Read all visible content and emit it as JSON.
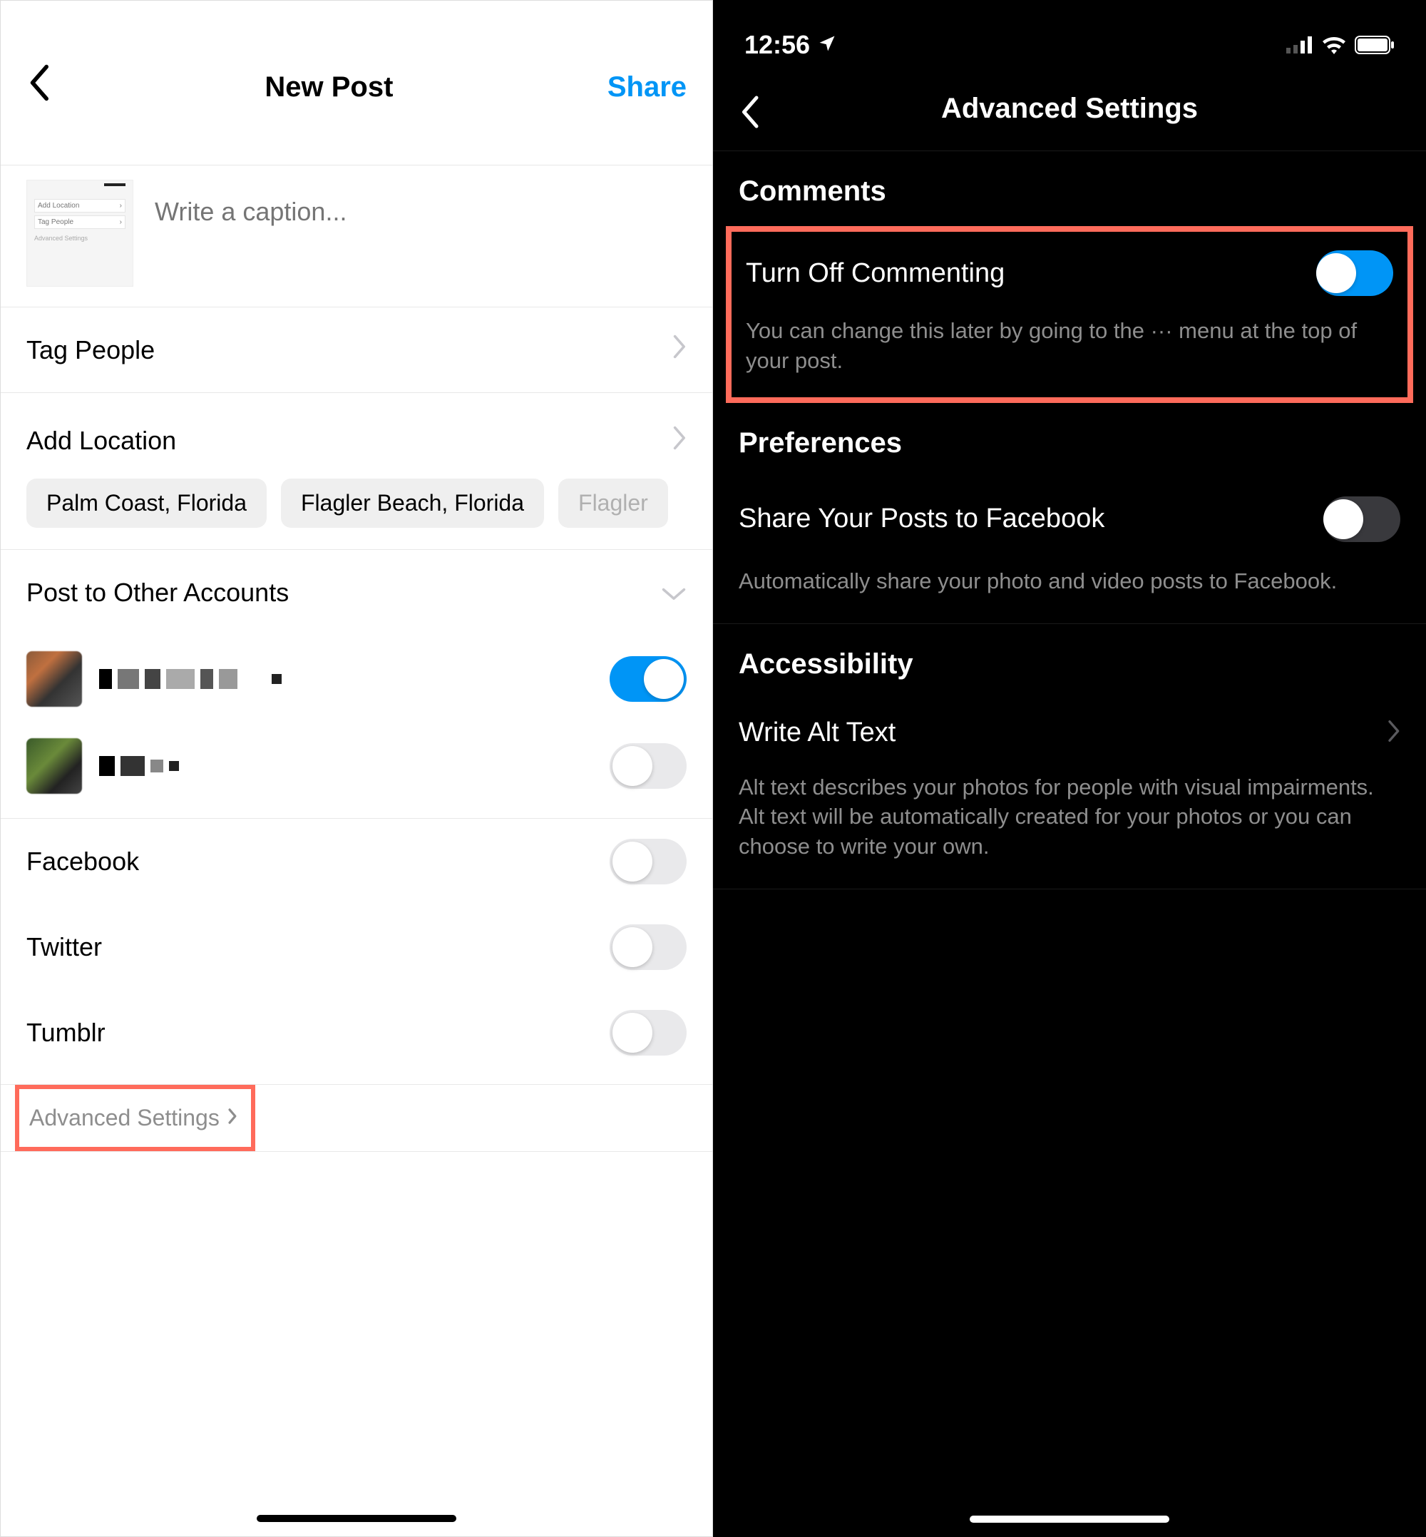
{
  "left": {
    "header": {
      "title": "New Post",
      "share": "Share"
    },
    "caption": {
      "placeholder": "Write a caption..."
    },
    "thumb": {
      "line1": "Add Location",
      "line2": "Tag People",
      "line3": "Advanced Settings"
    },
    "tag_people": {
      "label": "Tag People"
    },
    "add_location": {
      "label": "Add Location"
    },
    "location_chips": [
      "Palm Coast, Florida",
      "Flagler Beach, Florida",
      "Flagler"
    ],
    "post_other": {
      "label": "Post to Other Accounts"
    },
    "accounts": [
      {
        "on": true
      },
      {
        "on": false
      }
    ],
    "socials": [
      {
        "label": "Facebook",
        "on": false
      },
      {
        "label": "Twitter",
        "on": false
      },
      {
        "label": "Tumblr",
        "on": false
      }
    ],
    "advanced": {
      "label": "Advanced Settings"
    }
  },
  "right": {
    "status": {
      "time": "12:56"
    },
    "header": {
      "title": "Advanced Settings"
    },
    "comments": {
      "section": "Comments",
      "toggle_label": "Turn Off Commenting",
      "toggle_on": true,
      "desc": "You can change this later by going to the ··· menu at the top of your post."
    },
    "preferences": {
      "section": "Preferences",
      "toggle_label": "Share Your Posts to Facebook",
      "toggle_on": false,
      "desc": "Automatically share your photo and video posts to Facebook."
    },
    "accessibility": {
      "section": "Accessibility",
      "row_label": "Write Alt Text",
      "desc": "Alt text describes your photos for people with visual impairments. Alt text will be automatically created for your photos or you can choose to write your own."
    }
  },
  "colors": {
    "accent_blue": "#0095f6",
    "highlight_red": "#ff6b5b"
  }
}
